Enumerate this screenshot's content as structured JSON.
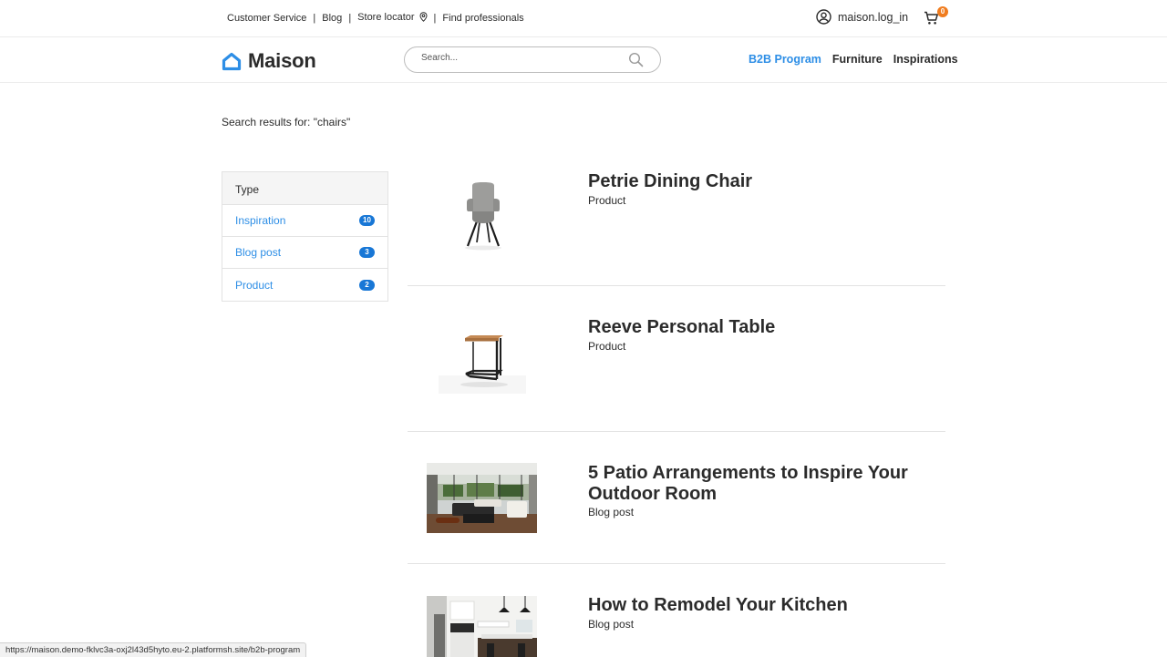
{
  "topbar": {
    "links": [
      "Customer Service",
      "Blog",
      "Store locator",
      "Find professionals"
    ],
    "separator": "|",
    "account_label": "maison.log_in",
    "cart_count": "0"
  },
  "header": {
    "brand": "Maison",
    "search_placeholder": "Search...",
    "nav": [
      "B2B Program",
      "Furniture",
      "Inspirations"
    ],
    "active_nav": "B2B Program"
  },
  "results": {
    "heading": "Search results for: \"chairs\"",
    "items": [
      {
        "title": "Petrie Dining Chair",
        "type": "Product",
        "thumb": "chair"
      },
      {
        "title": "Reeve Personal Table",
        "type": "Product",
        "thumb": "side-table"
      },
      {
        "title": "5 Patio Arrangements to Inspire Your Outdoor Room",
        "type": "Blog post",
        "thumb": "living-room-photo"
      },
      {
        "title": "How to Remodel Your Kitchen",
        "type": "Blog post",
        "thumb": "kitchen-photo"
      }
    ]
  },
  "facets": {
    "header": "Type",
    "items": [
      {
        "label": "Inspiration",
        "count": "10"
      },
      {
        "label": "Blog post",
        "count": "3"
      },
      {
        "label": "Product",
        "count": "2"
      }
    ]
  },
  "statusbar": {
    "url": "https://maison.demo-fklvc3a-oxj2l43d5hyto.eu-2.platformsh.site/b2b-program"
  },
  "colors": {
    "accent": "#2d8ee6",
    "badge": "#1877d6",
    "cart_badge": "#f07c1e",
    "text": "#2b2b2b"
  }
}
